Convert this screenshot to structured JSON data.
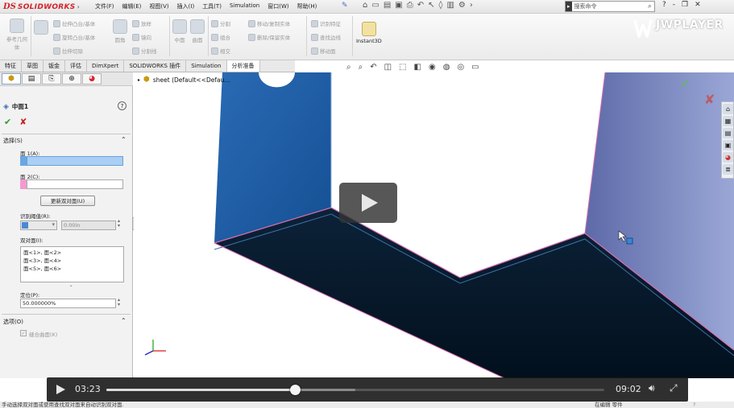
{
  "titlebar": {
    "brand_ds": "DS",
    "brand_name": "SOLIDWORKS",
    "menu": [
      "文件(F)",
      "编辑(E)",
      "视图(V)",
      "插入(I)",
      "工具(T)",
      "Simulation",
      "窗口(W)",
      "帮助(H)"
    ],
    "search_label": "搜索命令",
    "window_controls": [
      "?",
      "-",
      "❐",
      "✕"
    ]
  },
  "ribbon": {
    "watermark": "JWPLAYER",
    "groups": [
      [
        "参考几何体"
      ],
      [
        "拉伸凸台/基体",
        "旋转凸台/基体",
        "拉伸切除"
      ],
      [
        "放样",
        "圆角",
        "镜向",
        "分割线"
      ],
      [
        "中面",
        "曲面"
      ],
      [
        "分割",
        "组合",
        "相交"
      ],
      [
        "移动/复制实体",
        "删除/保留实体"
      ],
      [
        "识别特征",
        "查找边线",
        "移动面"
      ],
      [
        "Instant3D"
      ]
    ]
  },
  "tabs": [
    "特征",
    "草图",
    "钣金",
    "评估",
    "DimXpert",
    "SOLIDWORKS 插件",
    "Simulation",
    "分析准备"
  ],
  "active_tab": "分析准备",
  "property_manager": {
    "title": "中面1",
    "selection_section": "选择(S)",
    "face1_label": "面 1(A):",
    "face2_label": "面 2(C):",
    "update_button": "更新双对面(U)",
    "threshold_label": "识别阈值(R):",
    "threshold_value": "0.00in",
    "pairs_label": "双对面(I):",
    "pairs": [
      "面<1>, 面<2>",
      "面<3>, 面<4>",
      "面<5>, 面<6>"
    ],
    "position_label": "定位(P):",
    "position_value": "50.000000%",
    "options_section": "选项(O)",
    "knit_label": "缝合曲面(K)"
  },
  "tree": {
    "root": "sheet  (Default<<Defau..."
  },
  "player": {
    "current_time": "03:23",
    "duration": "09:02",
    "progress": 0.378,
    "buffered": 0.5
  },
  "statusbar": {
    "message": "手动选择双对面或使用查找双对面来自动识别双对面.",
    "mode": "在编辑 零件"
  },
  "colors": {
    "part_blue": "#1d5da6",
    "part_dark": "#031425",
    "highlight_pink": "#d86fb2",
    "selection_blue": "#a9cff5",
    "selection_pink": "#f39ad0"
  }
}
